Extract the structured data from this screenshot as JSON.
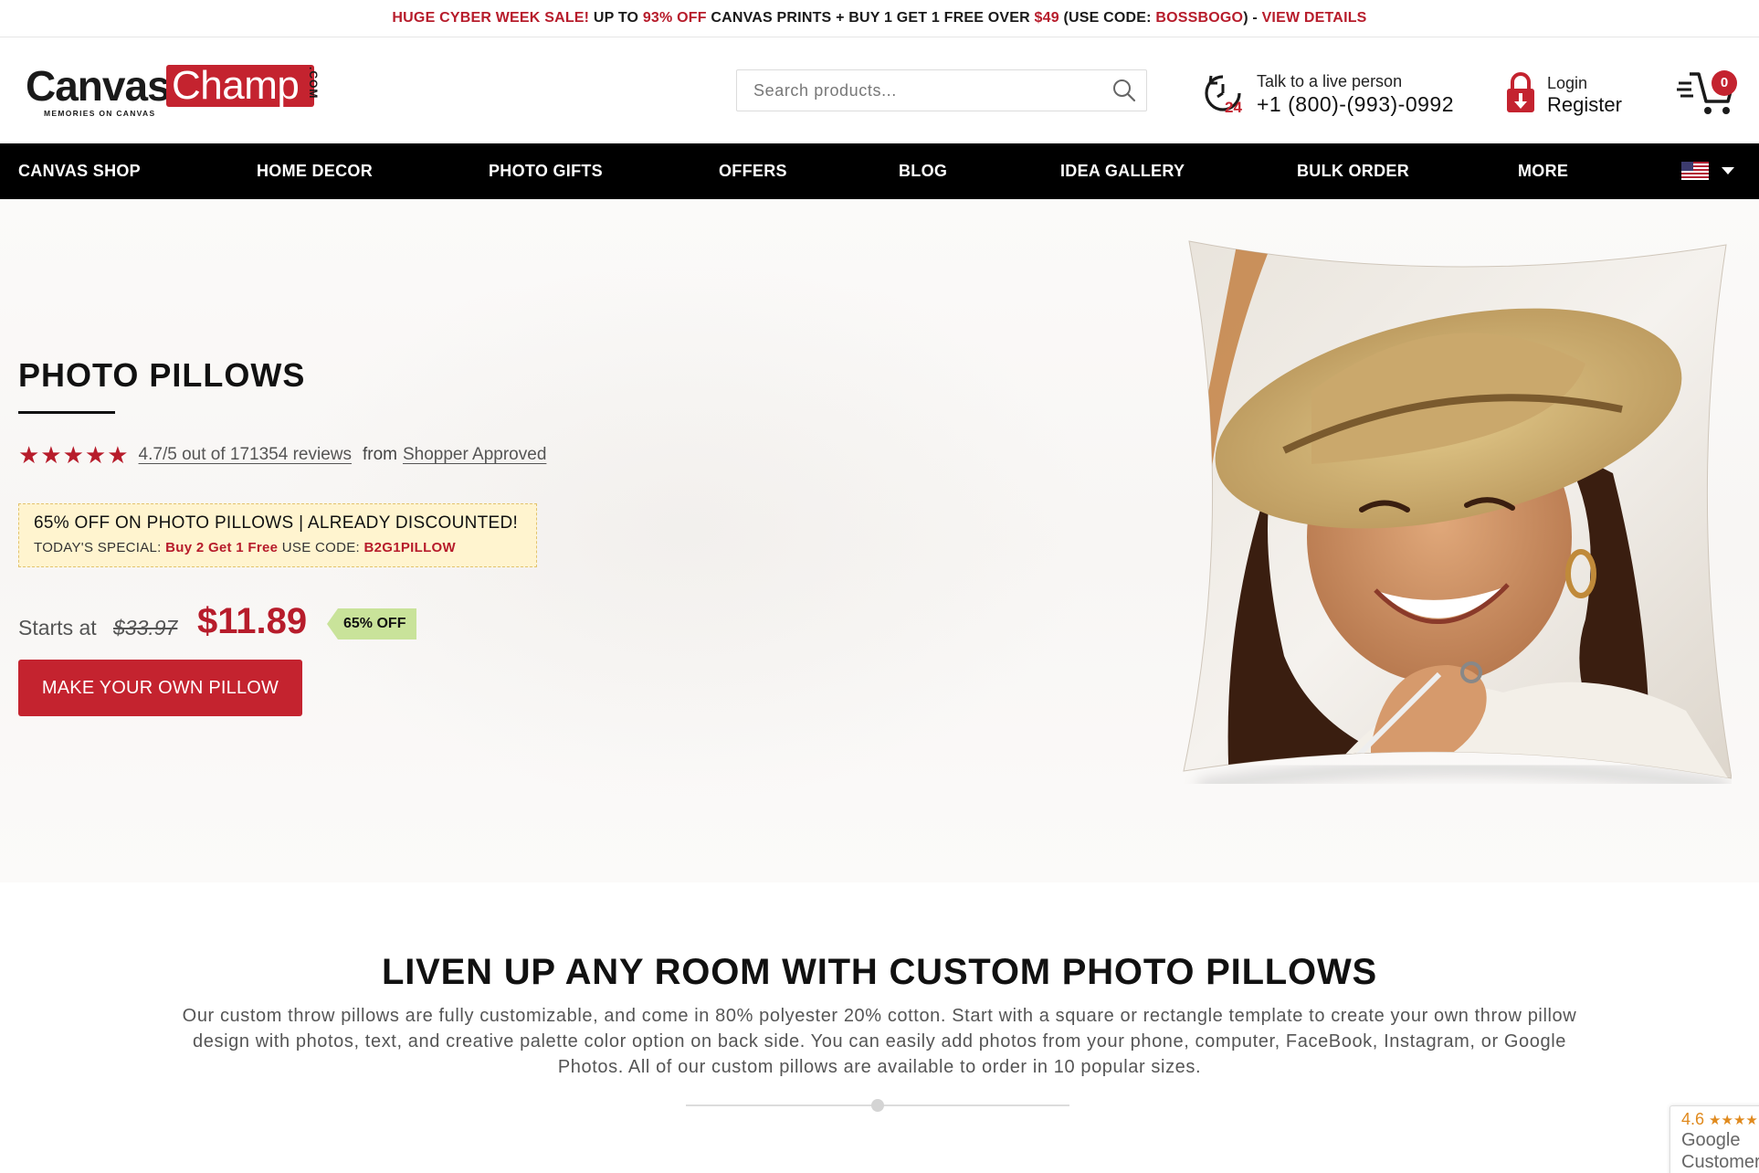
{
  "promo": {
    "part1": "HUGE CYBER WEEK SALE!",
    "part2": " UP TO ",
    "part3": "93% OFF",
    "part4": " CANVAS PRINTS + BUY 1 GET 1 FREE OVER ",
    "part5": "$49",
    "part6": " (USE CODE: ",
    "part7": "BOSSBOGO",
    "part8": ") - ",
    "link": "VIEW DETAILS"
  },
  "logo": {
    "word1": "Canvas",
    "word2": "Champ",
    "suffix": ".COM",
    "tagline": "MEMORIES ON CANVAS"
  },
  "search": {
    "placeholder": "Search products..."
  },
  "support": {
    "label": "Talk to a live person",
    "phone": "+1 (800)-(993)-0992",
    "icon_text": "24"
  },
  "account": {
    "login": "Login",
    "register": "Register"
  },
  "cart": {
    "count": "0"
  },
  "nav": {
    "items": [
      "CANVAS SHOP",
      "HOME DECOR",
      "PHOTO GIFTS",
      "OFFERS",
      "BLOG",
      "IDEA GALLERY",
      "BULK ORDER",
      "MORE"
    ],
    "country": "United States"
  },
  "hero": {
    "title": "PHOTO PILLOWS",
    "rating": {
      "stars": "★★★★★",
      "summary": "4.7/5 out of 171354 reviews",
      "from": "from",
      "source": "Shopper Approved",
      "value": 4.7
    },
    "offer": {
      "line1": "65% OFF ON PHOTO PILLOWS | ALREADY DISCOUNTED!",
      "line2_prefix": "TODAY'S SPECIAL: ",
      "line2_deal": "Buy 2 Get 1 Free",
      "line2_mid": " USE CODE: ",
      "line2_code": "B2G1PILLOW"
    },
    "price": {
      "starts": "Starts at",
      "old": "$33.97",
      "now": "$11.89",
      "discount": "65% OFF"
    },
    "cta": "MAKE YOUR OWN PILLOW"
  },
  "section": {
    "title": "LIVEN UP ANY ROOM WITH CUSTOM PHOTO PILLOWS",
    "description": "Our custom throw pillows are fully customizable, and come in 80% polyester 20% cotton. Start with a square or rectangle template to create your own throw pillow design with photos, text, and creative palette color option on back side. You can easily add photos from your phone, computer, FaceBook, Instagram, or Google Photos. All of our custom pillows are available to order in 10 popular sizes."
  },
  "google_badge": {
    "score": "4.6",
    "stars": "★★★★",
    "line1": "Google",
    "line2": "Customer"
  },
  "colors": {
    "brand_red": "#c4232f",
    "nav_bg": "#000000",
    "offer_bg": "#fff4cf",
    "tag_green": "#c9e39a"
  }
}
